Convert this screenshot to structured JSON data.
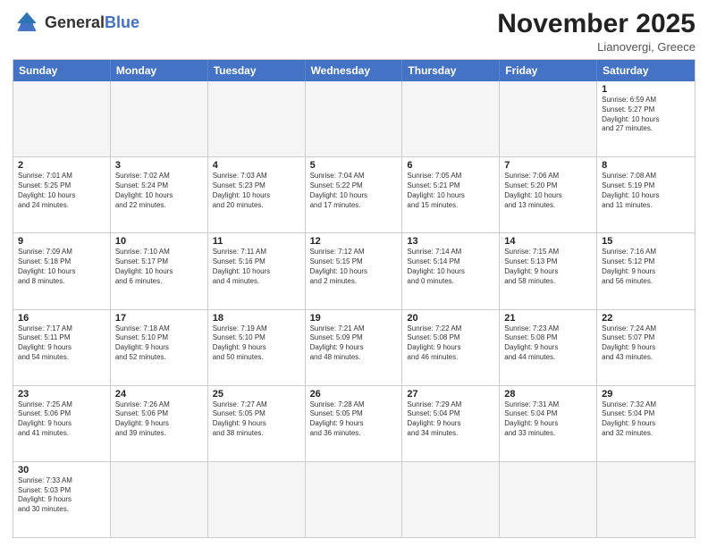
{
  "header": {
    "logo_general": "General",
    "logo_blue": "Blue",
    "month_title": "November 2025",
    "location": "Lianovergi, Greece"
  },
  "weekdays": [
    "Sunday",
    "Monday",
    "Tuesday",
    "Wednesday",
    "Thursday",
    "Friday",
    "Saturday"
  ],
  "rows": [
    [
      {
        "day": "",
        "info": "",
        "empty": true
      },
      {
        "day": "",
        "info": "",
        "empty": true
      },
      {
        "day": "",
        "info": "",
        "empty": true
      },
      {
        "day": "",
        "info": "",
        "empty": true
      },
      {
        "day": "",
        "info": "",
        "empty": true
      },
      {
        "day": "",
        "info": "",
        "empty": true
      },
      {
        "day": "1",
        "info": "Sunrise: 6:59 AM\nSunset: 5:27 PM\nDaylight: 10 hours\nand 27 minutes."
      }
    ],
    [
      {
        "day": "2",
        "info": "Sunrise: 7:01 AM\nSunset: 5:25 PM\nDaylight: 10 hours\nand 24 minutes."
      },
      {
        "day": "3",
        "info": "Sunrise: 7:02 AM\nSunset: 5:24 PM\nDaylight: 10 hours\nand 22 minutes."
      },
      {
        "day": "4",
        "info": "Sunrise: 7:03 AM\nSunset: 5:23 PM\nDaylight: 10 hours\nand 20 minutes."
      },
      {
        "day": "5",
        "info": "Sunrise: 7:04 AM\nSunset: 5:22 PM\nDaylight: 10 hours\nand 17 minutes."
      },
      {
        "day": "6",
        "info": "Sunrise: 7:05 AM\nSunset: 5:21 PM\nDaylight: 10 hours\nand 15 minutes."
      },
      {
        "day": "7",
        "info": "Sunrise: 7:06 AM\nSunset: 5:20 PM\nDaylight: 10 hours\nand 13 minutes."
      },
      {
        "day": "8",
        "info": "Sunrise: 7:08 AM\nSunset: 5:19 PM\nDaylight: 10 hours\nand 11 minutes."
      }
    ],
    [
      {
        "day": "9",
        "info": "Sunrise: 7:09 AM\nSunset: 5:18 PM\nDaylight: 10 hours\nand 8 minutes."
      },
      {
        "day": "10",
        "info": "Sunrise: 7:10 AM\nSunset: 5:17 PM\nDaylight: 10 hours\nand 6 minutes."
      },
      {
        "day": "11",
        "info": "Sunrise: 7:11 AM\nSunset: 5:16 PM\nDaylight: 10 hours\nand 4 minutes."
      },
      {
        "day": "12",
        "info": "Sunrise: 7:12 AM\nSunset: 5:15 PM\nDaylight: 10 hours\nand 2 minutes."
      },
      {
        "day": "13",
        "info": "Sunrise: 7:14 AM\nSunset: 5:14 PM\nDaylight: 10 hours\nand 0 minutes."
      },
      {
        "day": "14",
        "info": "Sunrise: 7:15 AM\nSunset: 5:13 PM\nDaylight: 9 hours\nand 58 minutes."
      },
      {
        "day": "15",
        "info": "Sunrise: 7:16 AM\nSunset: 5:12 PM\nDaylight: 9 hours\nand 56 minutes."
      }
    ],
    [
      {
        "day": "16",
        "info": "Sunrise: 7:17 AM\nSunset: 5:11 PM\nDaylight: 9 hours\nand 54 minutes."
      },
      {
        "day": "17",
        "info": "Sunrise: 7:18 AM\nSunset: 5:10 PM\nDaylight: 9 hours\nand 52 minutes."
      },
      {
        "day": "18",
        "info": "Sunrise: 7:19 AM\nSunset: 5:10 PM\nDaylight: 9 hours\nand 50 minutes."
      },
      {
        "day": "19",
        "info": "Sunrise: 7:21 AM\nSunset: 5:09 PM\nDaylight: 9 hours\nand 48 minutes."
      },
      {
        "day": "20",
        "info": "Sunrise: 7:22 AM\nSunset: 5:08 PM\nDaylight: 9 hours\nand 46 minutes."
      },
      {
        "day": "21",
        "info": "Sunrise: 7:23 AM\nSunset: 5:08 PM\nDaylight: 9 hours\nand 44 minutes."
      },
      {
        "day": "22",
        "info": "Sunrise: 7:24 AM\nSunset: 5:07 PM\nDaylight: 9 hours\nand 43 minutes."
      }
    ],
    [
      {
        "day": "23",
        "info": "Sunrise: 7:25 AM\nSunset: 5:06 PM\nDaylight: 9 hours\nand 41 minutes."
      },
      {
        "day": "24",
        "info": "Sunrise: 7:26 AM\nSunset: 5:06 PM\nDaylight: 9 hours\nand 39 minutes."
      },
      {
        "day": "25",
        "info": "Sunrise: 7:27 AM\nSunset: 5:05 PM\nDaylight: 9 hours\nand 38 minutes."
      },
      {
        "day": "26",
        "info": "Sunrise: 7:28 AM\nSunset: 5:05 PM\nDaylight: 9 hours\nand 36 minutes."
      },
      {
        "day": "27",
        "info": "Sunrise: 7:29 AM\nSunset: 5:04 PM\nDaylight: 9 hours\nand 34 minutes."
      },
      {
        "day": "28",
        "info": "Sunrise: 7:31 AM\nSunset: 5:04 PM\nDaylight: 9 hours\nand 33 minutes."
      },
      {
        "day": "29",
        "info": "Sunrise: 7:32 AM\nSunset: 5:04 PM\nDaylight: 9 hours\nand 32 minutes."
      }
    ],
    [
      {
        "day": "30",
        "info": "Sunrise: 7:33 AM\nSunset: 5:03 PM\nDaylight: 9 hours\nand 30 minutes."
      },
      {
        "day": "",
        "info": "",
        "empty": true
      },
      {
        "day": "",
        "info": "",
        "empty": true
      },
      {
        "day": "",
        "info": "",
        "empty": true
      },
      {
        "day": "",
        "info": "",
        "empty": true
      },
      {
        "day": "",
        "info": "",
        "empty": true
      },
      {
        "day": "",
        "info": "",
        "empty": true
      }
    ]
  ]
}
